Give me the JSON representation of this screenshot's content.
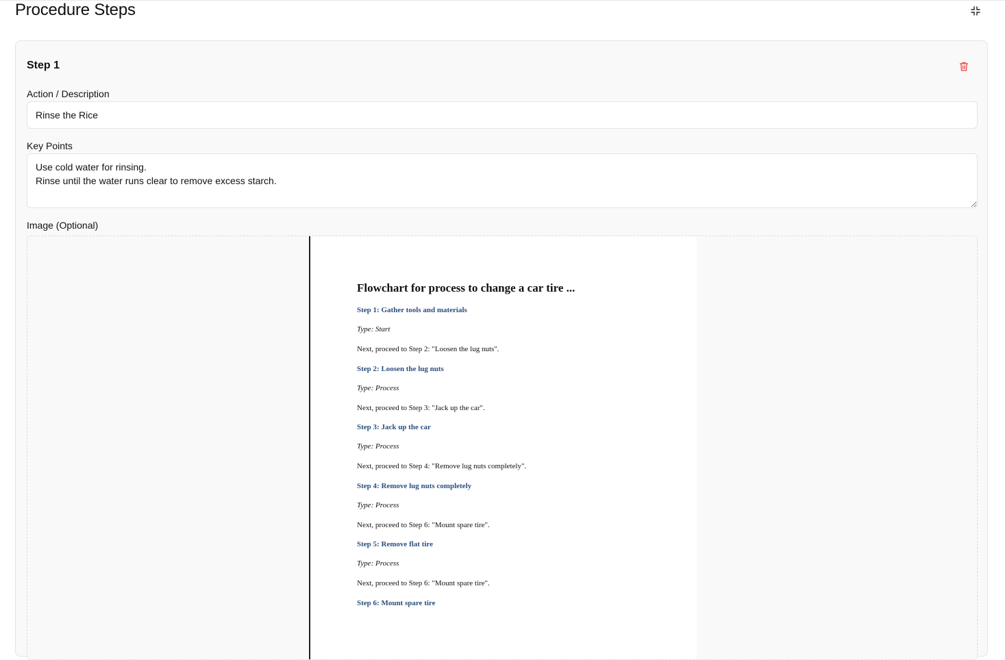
{
  "page": {
    "title": "Procedure Steps"
  },
  "icons": {
    "collapse": "collapse-icon",
    "delete": "trash-icon",
    "accent_delete_color": "#ef4444"
  },
  "step": {
    "title": "Step 1",
    "action": {
      "label": "Action / Description",
      "value": "Rinse the Rice"
    },
    "key_points": {
      "label": "Key Points",
      "value": "Use cold water for rinsing.\nRinse until the water runs clear to remove excess starch."
    },
    "image": {
      "label": "Image (Optional)",
      "document": {
        "heading": "Flowchart for process to change a car tire ...",
        "steps": [
          {
            "title": "Step 1: Gather tools and materials",
            "type": "Type: Start",
            "next": "Next, proceed to Step 2: \"Loosen the lug nuts\"."
          },
          {
            "title": "Step 2: Loosen the lug nuts",
            "type": "Type: Process",
            "next": "Next, proceed to Step 3: \"Jack up the car\"."
          },
          {
            "title": "Step 3: Jack up the car",
            "type": "Type: Process",
            "next": "Next, proceed to Step 4: \"Remove lug nuts completely\"."
          },
          {
            "title": "Step 4: Remove lug nuts completely",
            "type": "Type: Process",
            "next": "Next, proceed to Step 6: \"Mount spare tire\"."
          },
          {
            "title": "Step 5: Remove flat tire",
            "type": "Type: Process",
            "next": "Next, proceed to Step 6: \"Mount spare tire\"."
          },
          {
            "title": "Step 6: Mount spare tire",
            "type": "",
            "next": ""
          }
        ]
      }
    }
  }
}
